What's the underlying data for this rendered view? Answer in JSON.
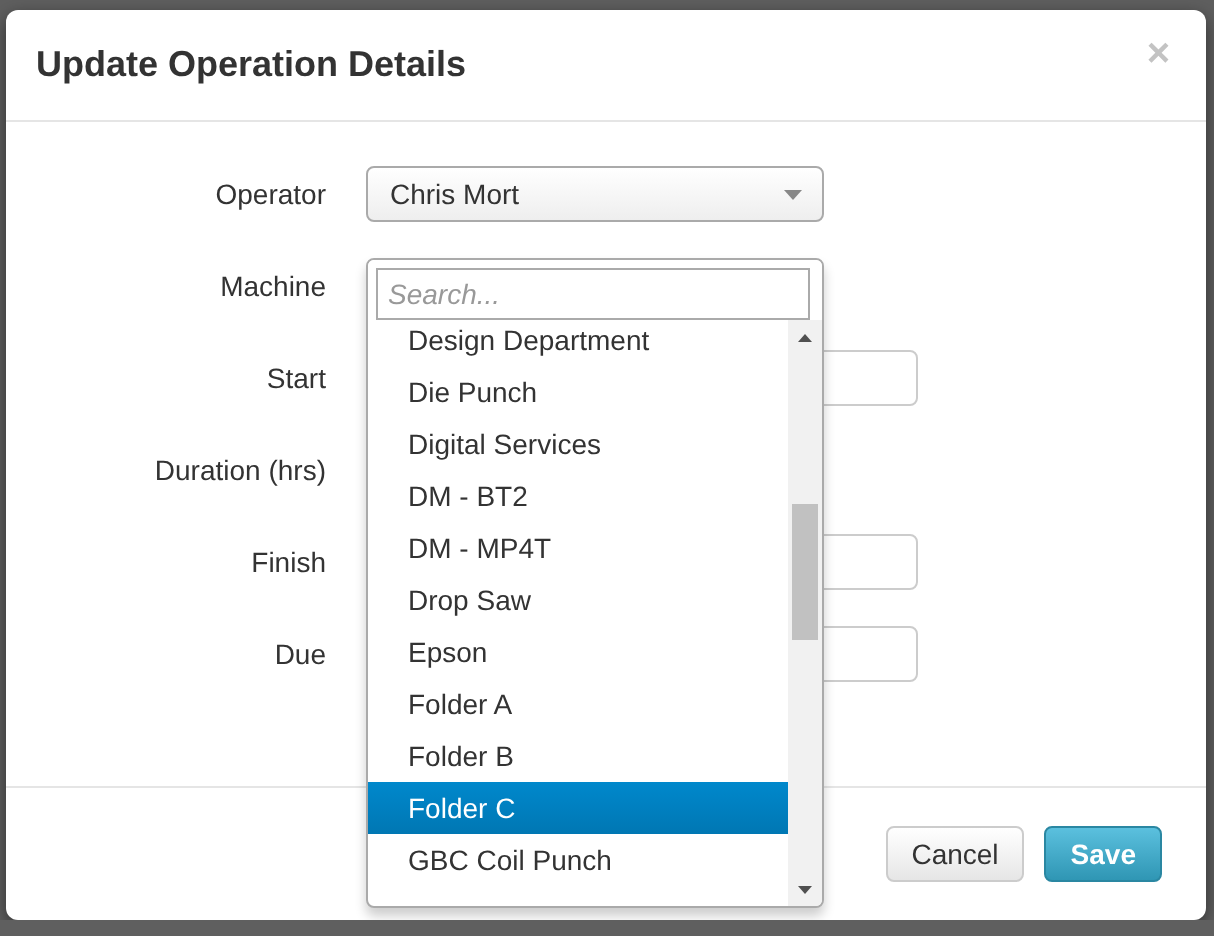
{
  "dialog": {
    "title": "Update Operation Details",
    "close": "×"
  },
  "fields": [
    {
      "label": "Operator",
      "kind": "select",
      "value": "Chris Mort"
    },
    {
      "label": "Machine",
      "kind": "dropdown"
    },
    {
      "label": "Start",
      "kind": "input"
    },
    {
      "label": "Duration (hrs)",
      "kind": "label_only"
    },
    {
      "label": "Finish",
      "kind": "input"
    },
    {
      "label": "Due",
      "kind": "input"
    }
  ],
  "machine_dropdown": {
    "placeholder": "Search...",
    "options": [
      {
        "label": "Design Department",
        "selected": false
      },
      {
        "label": "Die Punch",
        "selected": false
      },
      {
        "label": "Digital Services",
        "selected": false
      },
      {
        "label": "DM - BT2",
        "selected": false
      },
      {
        "label": "DM - MP4T",
        "selected": false
      },
      {
        "label": "Drop Saw",
        "selected": false
      },
      {
        "label": "Epson",
        "selected": false
      },
      {
        "label": "Folder A",
        "selected": false
      },
      {
        "label": "Folder B",
        "selected": false
      },
      {
        "label": "Folder C",
        "selected": true
      },
      {
        "label": "GBC Coil Punch",
        "selected": false
      }
    ]
  },
  "buttons": [
    {
      "label": "Cancel",
      "kind": "default"
    },
    {
      "label": "Save",
      "kind": "primary"
    }
  ]
}
